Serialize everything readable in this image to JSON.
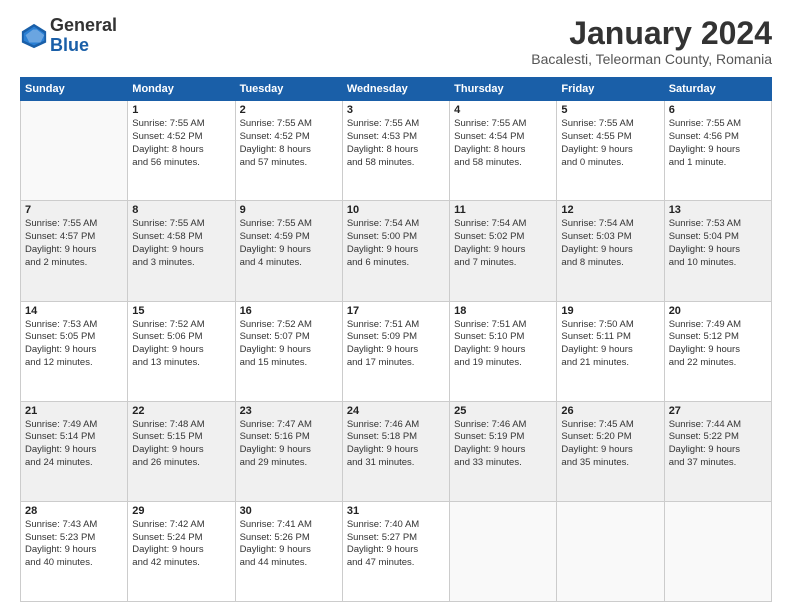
{
  "header": {
    "logo_general": "General",
    "logo_blue": "Blue",
    "month_title": "January 2024",
    "location": "Bacalesti, Teleorman County, Romania"
  },
  "days_of_week": [
    "Sunday",
    "Monday",
    "Tuesday",
    "Wednesday",
    "Thursday",
    "Friday",
    "Saturday"
  ],
  "weeks": [
    [
      {
        "num": "",
        "info": ""
      },
      {
        "num": "1",
        "info": "Sunrise: 7:55 AM\nSunset: 4:52 PM\nDaylight: 8 hours\nand 56 minutes."
      },
      {
        "num": "2",
        "info": "Sunrise: 7:55 AM\nSunset: 4:52 PM\nDaylight: 8 hours\nand 57 minutes."
      },
      {
        "num": "3",
        "info": "Sunrise: 7:55 AM\nSunset: 4:53 PM\nDaylight: 8 hours\nand 58 minutes."
      },
      {
        "num": "4",
        "info": "Sunrise: 7:55 AM\nSunset: 4:54 PM\nDaylight: 8 hours\nand 58 minutes."
      },
      {
        "num": "5",
        "info": "Sunrise: 7:55 AM\nSunset: 4:55 PM\nDaylight: 9 hours\nand 0 minutes."
      },
      {
        "num": "6",
        "info": "Sunrise: 7:55 AM\nSunset: 4:56 PM\nDaylight: 9 hours\nand 1 minute."
      }
    ],
    [
      {
        "num": "7",
        "info": "Sunrise: 7:55 AM\nSunset: 4:57 PM\nDaylight: 9 hours\nand 2 minutes."
      },
      {
        "num": "8",
        "info": "Sunrise: 7:55 AM\nSunset: 4:58 PM\nDaylight: 9 hours\nand 3 minutes."
      },
      {
        "num": "9",
        "info": "Sunrise: 7:55 AM\nSunset: 4:59 PM\nDaylight: 9 hours\nand 4 minutes."
      },
      {
        "num": "10",
        "info": "Sunrise: 7:54 AM\nSunset: 5:00 PM\nDaylight: 9 hours\nand 6 minutes."
      },
      {
        "num": "11",
        "info": "Sunrise: 7:54 AM\nSunset: 5:02 PM\nDaylight: 9 hours\nand 7 minutes."
      },
      {
        "num": "12",
        "info": "Sunrise: 7:54 AM\nSunset: 5:03 PM\nDaylight: 9 hours\nand 8 minutes."
      },
      {
        "num": "13",
        "info": "Sunrise: 7:53 AM\nSunset: 5:04 PM\nDaylight: 9 hours\nand 10 minutes."
      }
    ],
    [
      {
        "num": "14",
        "info": "Sunrise: 7:53 AM\nSunset: 5:05 PM\nDaylight: 9 hours\nand 12 minutes."
      },
      {
        "num": "15",
        "info": "Sunrise: 7:52 AM\nSunset: 5:06 PM\nDaylight: 9 hours\nand 13 minutes."
      },
      {
        "num": "16",
        "info": "Sunrise: 7:52 AM\nSunset: 5:07 PM\nDaylight: 9 hours\nand 15 minutes."
      },
      {
        "num": "17",
        "info": "Sunrise: 7:51 AM\nSunset: 5:09 PM\nDaylight: 9 hours\nand 17 minutes."
      },
      {
        "num": "18",
        "info": "Sunrise: 7:51 AM\nSunset: 5:10 PM\nDaylight: 9 hours\nand 19 minutes."
      },
      {
        "num": "19",
        "info": "Sunrise: 7:50 AM\nSunset: 5:11 PM\nDaylight: 9 hours\nand 21 minutes."
      },
      {
        "num": "20",
        "info": "Sunrise: 7:49 AM\nSunset: 5:12 PM\nDaylight: 9 hours\nand 22 minutes."
      }
    ],
    [
      {
        "num": "21",
        "info": "Sunrise: 7:49 AM\nSunset: 5:14 PM\nDaylight: 9 hours\nand 24 minutes."
      },
      {
        "num": "22",
        "info": "Sunrise: 7:48 AM\nSunset: 5:15 PM\nDaylight: 9 hours\nand 26 minutes."
      },
      {
        "num": "23",
        "info": "Sunrise: 7:47 AM\nSunset: 5:16 PM\nDaylight: 9 hours\nand 29 minutes."
      },
      {
        "num": "24",
        "info": "Sunrise: 7:46 AM\nSunset: 5:18 PM\nDaylight: 9 hours\nand 31 minutes."
      },
      {
        "num": "25",
        "info": "Sunrise: 7:46 AM\nSunset: 5:19 PM\nDaylight: 9 hours\nand 33 minutes."
      },
      {
        "num": "26",
        "info": "Sunrise: 7:45 AM\nSunset: 5:20 PM\nDaylight: 9 hours\nand 35 minutes."
      },
      {
        "num": "27",
        "info": "Sunrise: 7:44 AM\nSunset: 5:22 PM\nDaylight: 9 hours\nand 37 minutes."
      }
    ],
    [
      {
        "num": "28",
        "info": "Sunrise: 7:43 AM\nSunset: 5:23 PM\nDaylight: 9 hours\nand 40 minutes."
      },
      {
        "num": "29",
        "info": "Sunrise: 7:42 AM\nSunset: 5:24 PM\nDaylight: 9 hours\nand 42 minutes."
      },
      {
        "num": "30",
        "info": "Sunrise: 7:41 AM\nSunset: 5:26 PM\nDaylight: 9 hours\nand 44 minutes."
      },
      {
        "num": "31",
        "info": "Sunrise: 7:40 AM\nSunset: 5:27 PM\nDaylight: 9 hours\nand 47 minutes."
      },
      {
        "num": "",
        "info": ""
      },
      {
        "num": "",
        "info": ""
      },
      {
        "num": "",
        "info": ""
      }
    ]
  ]
}
